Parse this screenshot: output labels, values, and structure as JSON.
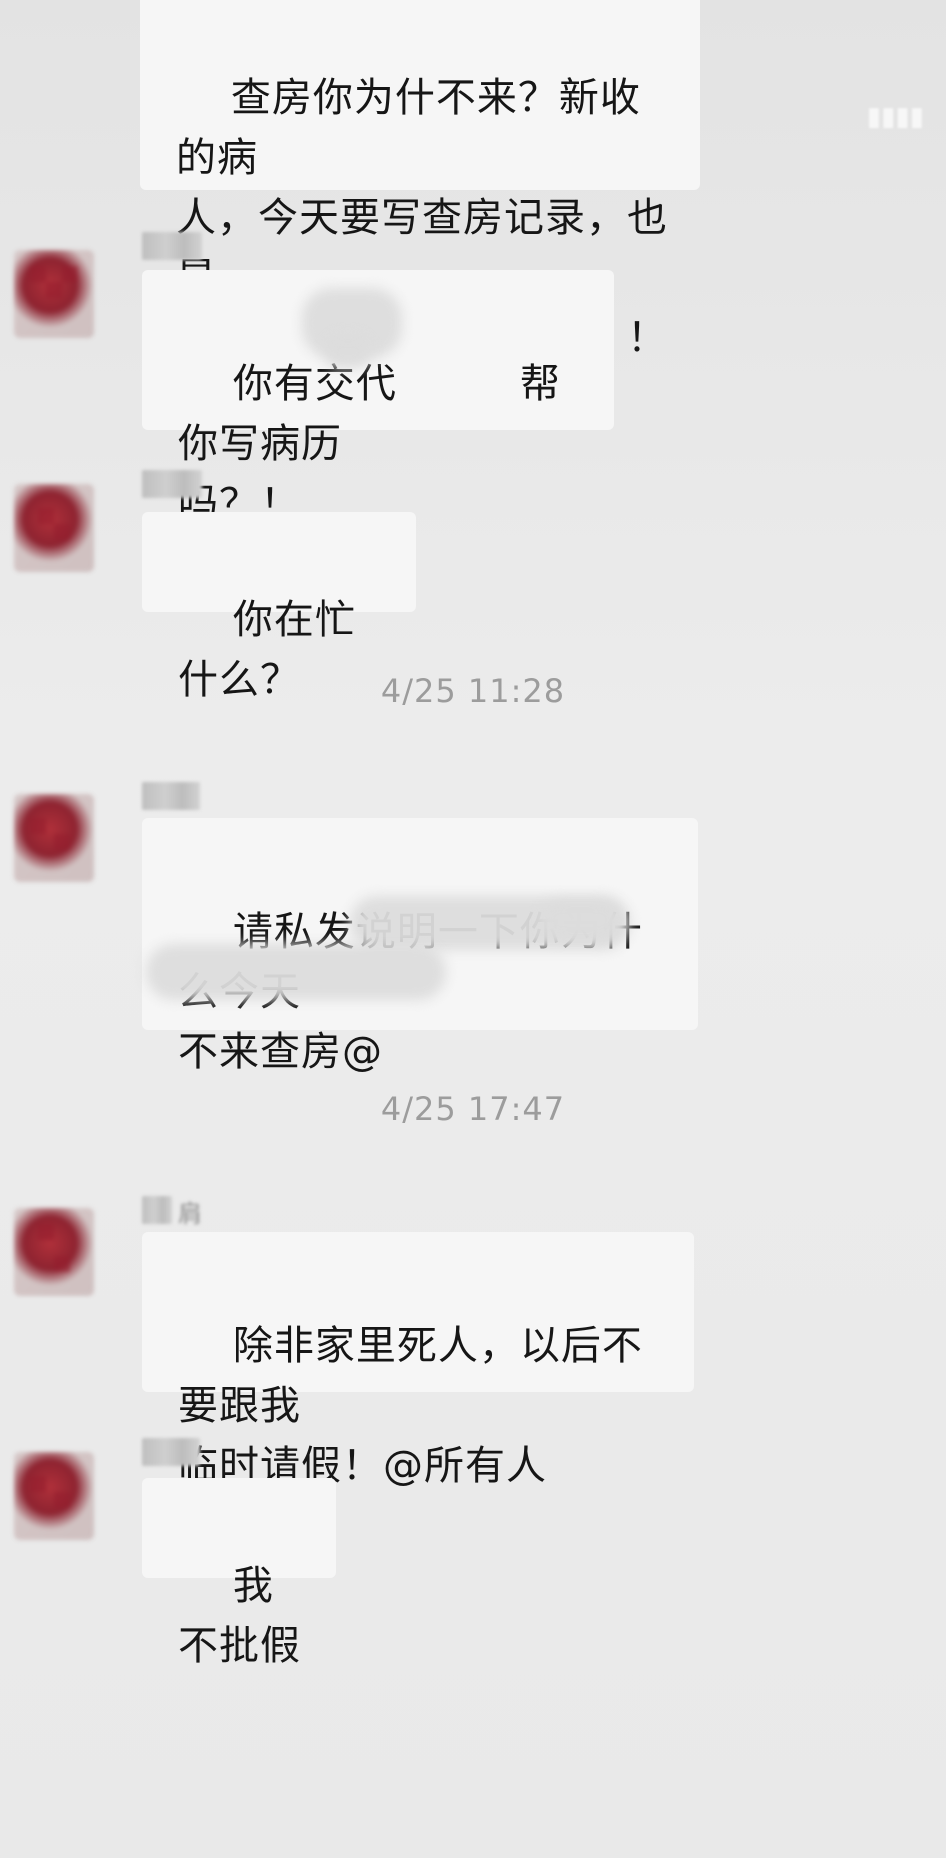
{
  "messages": [
    {
      "text": "查房你为什不来？新收的病\n人，今天要写查房记录，也是\n你的病人，为什么不来？！"
    },
    {
      "text": "你有交代　　　帮你写病历\n吗？！"
    },
    {
      "text": "你在忙什么？"
    },
    {
      "text": "请私发说明一下你为什么今天\n不来查房@"
    },
    {
      "text": "除非家里死人，以后不要跟我\n临时请假！@所有人"
    },
    {
      "text": "我不批假"
    }
  ],
  "timestamps": [
    "4/25 11:28",
    "4/25 17:47"
  ],
  "nickname_glyph": "肩",
  "colors": {
    "background": "#e9e9e9",
    "bubble": "#f6f6f6",
    "timestamp": "#9c9c9c",
    "avatar": "#8e2330"
  }
}
